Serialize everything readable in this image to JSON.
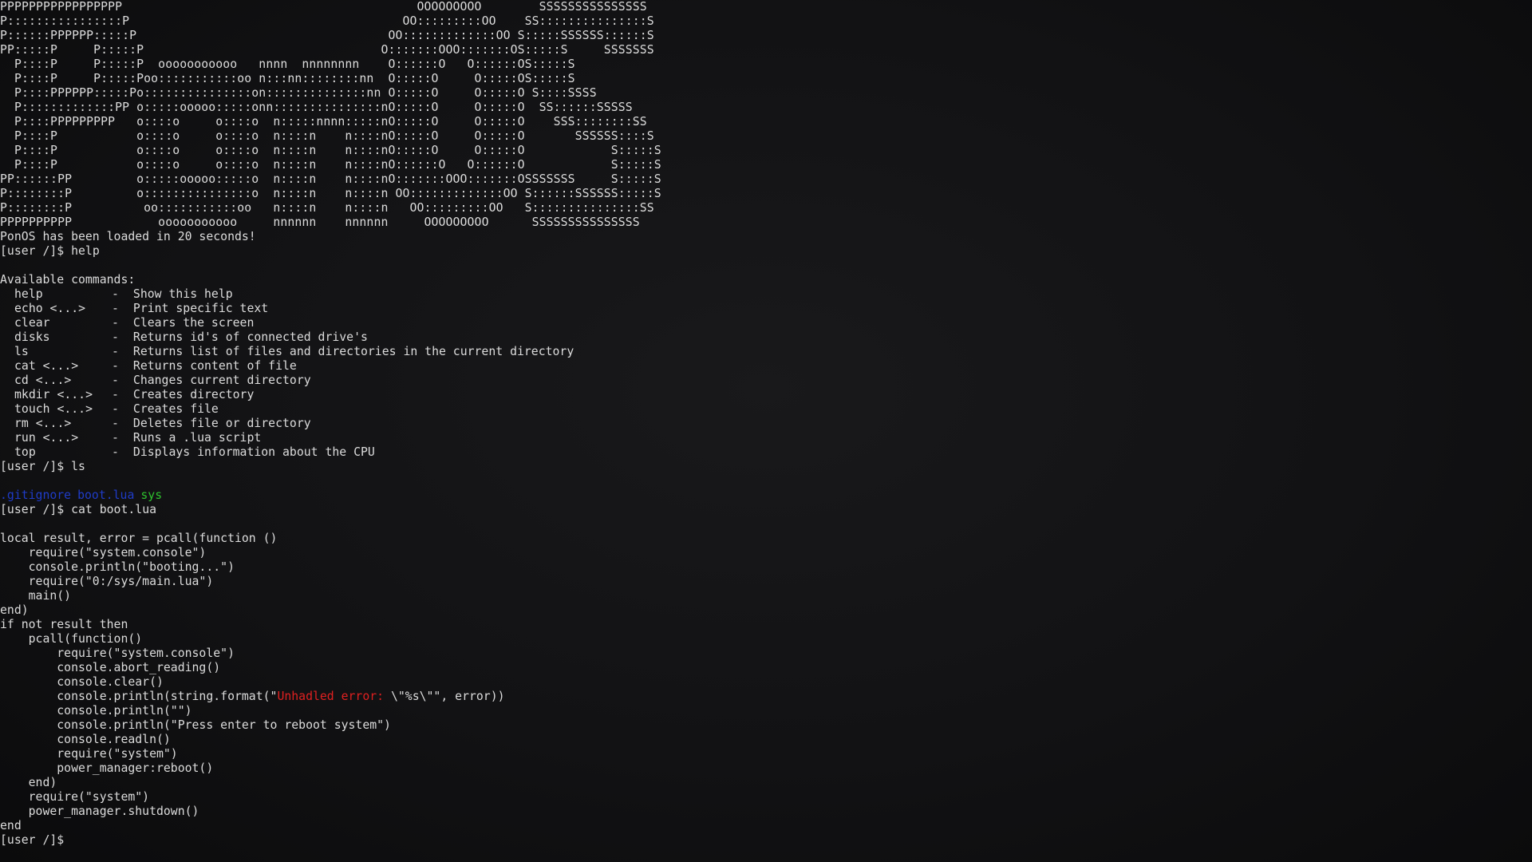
{
  "banner": [
    "PPPPPPPPPPPPPPPPP                                         OOOOOOOOO        SSSSSSSSSSSSSSS",
    "P::::::::::::::::P                                      OO:::::::::OO    SS:::::::::::::::S",
    "P::::::PPPPPP:::::P                                   OO:::::::::::::OO S:::::SSSSSS::::::S",
    "PP:::::P     P:::::P                                 O:::::::OOO:::::::OS:::::S     SSSSSSS",
    "  P::::P     P:::::P  ooooooooooo   nnnn  nnnnnnnn    O::::::O   O::::::OS:::::S",
    "  P::::P     P:::::Poo:::::::::::oo n:::nn::::::::nn  O:::::O     O:::::OS:::::S",
    "  P::::PPPPPP:::::Po:::::::::::::::on::::::::::::::nn O:::::O     O:::::O S::::SSSS",
    "  P:::::::::::::PP o:::::ooooo:::::onn:::::::::::::::nO:::::O     O:::::O  SS::::::SSSSS",
    "  P::::PPPPPPPPP   o::::o     o::::o  n:::::nnnn:::::nO:::::O     O:::::O    SSS::::::::SS",
    "  P::::P           o::::o     o::::o  n::::n    n::::nO:::::O     O:::::O       SSSSSS::::S",
    "  P::::P           o::::o     o::::o  n::::n    n::::nO:::::O     O:::::O            S:::::S",
    "  P::::P           o::::o     o::::o  n::::n    n::::nO::::::O   O::::::O            S:::::S",
    "PP::::::PP         o:::::ooooo:::::o  n::::n    n::::nO:::::::OOO:::::::OSSSSSSS     S:::::S",
    "P::::::::P         o:::::::::::::::o  n::::n    n::::n OO:::::::::::::OO S::::::SSSSSS:::::S",
    "P::::::::P          oo:::::::::::oo   n::::n    n::::n   OO:::::::::OO   S:::::::::::::::SS",
    "PPPPPPPPPP            ooooooooooo     nnnnnn    nnnnnn     OOOOOOOOO      SSSSSSSSSSSSSSS"
  ],
  "boot_message": "PonOS has been loaded in 20 seconds!",
  "prompt": "[user /]$",
  "session": {
    "cmd1": "help",
    "help_header": "Available commands:",
    "commands": [
      {
        "name": "help",
        "desc": "Show this help"
      },
      {
        "name": "echo <...>",
        "desc": "Print specific text"
      },
      {
        "name": "clear",
        "desc": "Clears the screen"
      },
      {
        "name": "disks",
        "desc": "Returns id's of connected drive's"
      },
      {
        "name": "ls",
        "desc": "Returns list of files and directories in the current directory"
      },
      {
        "name": "cat <...>",
        "desc": "Returns content of file"
      },
      {
        "name": "cd <...>",
        "desc": "Changes current directory"
      },
      {
        "name": "mkdir <...>",
        "desc": "Creates directory"
      },
      {
        "name": "touch <...>",
        "desc": "Creates file"
      },
      {
        "name": "rm <...>",
        "desc": "Deletes file or directory"
      },
      {
        "name": "run <...>",
        "desc": "Runs a .lua script"
      },
      {
        "name": "top",
        "desc": "Displays information about the CPU"
      }
    ],
    "separator": "-",
    "cmd2": "ls",
    "ls_output": [
      {
        "name": ".gitignore",
        "kind": "file"
      },
      {
        "name": "boot.lua",
        "kind": "file"
      },
      {
        "name": "sys",
        "kind": "dir"
      }
    ],
    "cmd3": "cat boot.lua",
    "file_lines": [
      {
        "text": "local result, error = pcall(function ()"
      },
      {
        "text": "    require(\"system.console\")"
      },
      {
        "text": "    console.println(\"booting...\")"
      },
      {
        "text": "    require(\"0:/sys/main.lua\")"
      },
      {
        "text": "    main()"
      },
      {
        "text": "end)"
      },
      {
        "text": "if not result then"
      },
      {
        "text": "    pcall(function()"
      },
      {
        "text": "        require(\"system.console\")"
      },
      {
        "text": "        console.abort_reading()"
      },
      {
        "text": "        console.clear()"
      },
      {
        "pre": "        console.println(string.format(\"",
        "red": "Unhadled error: ",
        "post": "\\\"%s\\\"\", error))"
      },
      {
        "text": "        console.println(\"\")"
      },
      {
        "text": "        console.println(\"Press enter to reboot system\")"
      },
      {
        "text": "        console.readln()"
      },
      {
        "text": "        require(\"system\")"
      },
      {
        "text": "        power_manager:reboot()"
      },
      {
        "text": "    end)"
      },
      {
        "text": "    require(\"system\")"
      },
      {
        "text": "    power_manager.shutdown()"
      },
      {
        "text": "end"
      }
    ]
  },
  "colors": {
    "background": "#121214",
    "text": "#dcdcdc",
    "ls_file": "#1f3cc8",
    "ls_dir": "#2ec22e",
    "error_string": "#e02020"
  }
}
